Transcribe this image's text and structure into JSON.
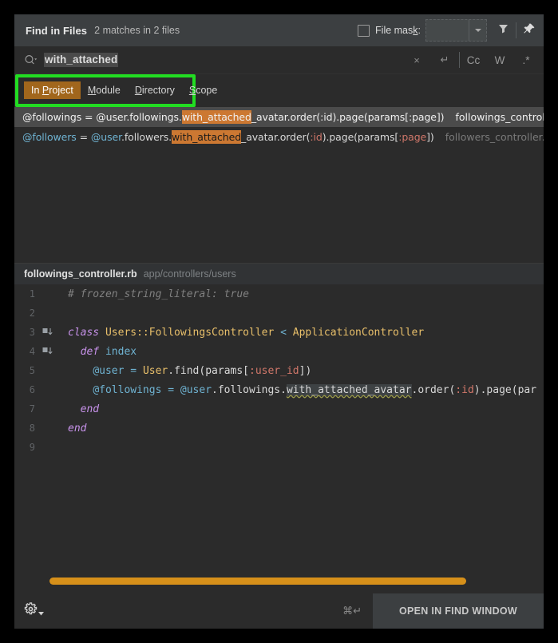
{
  "header": {
    "title": "Find in Files",
    "match_count": "2 matches in 2 files",
    "file_mask_label": "File mask:",
    "file_mask_checked": false,
    "file_mask_value": "",
    "filter_icon": "filter-icon",
    "pin_icon": "pin-icon"
  },
  "search": {
    "value": "with_attached",
    "placeholder": "",
    "search_icon": "search-icon",
    "clear_label": "×",
    "newline_label": "↵",
    "toggles": [
      {
        "label": "Cc",
        "name": "match-case-toggle"
      },
      {
        "label": "W",
        "name": "words-toggle"
      },
      {
        "label": ".*",
        "name": "regex-toggle"
      }
    ]
  },
  "scope": {
    "highlight_color": "#22dd22",
    "active_color": "#a1661c",
    "tabs": [
      {
        "label": "In Project",
        "mnemonic_before": "In ",
        "mnemonic": "P",
        "mnemonic_after": "roject",
        "active": true
      },
      {
        "label": "Module",
        "mnemonic_before": "",
        "mnemonic": "M",
        "mnemonic_after": "odule",
        "active": false
      },
      {
        "label": "Directory",
        "mnemonic_before": "",
        "mnemonic": "D",
        "mnemonic_after": "irectory",
        "active": false
      },
      {
        "label": "Scope",
        "mnemonic_before": "",
        "mnemonic": "S",
        "mnemonic_after": "cope",
        "active": false
      }
    ]
  },
  "results": [
    {
      "selected": true,
      "file": "followings_controller.rb",
      "line": "6",
      "parts": [
        {
          "t": "@followings = @user.followings.",
          "c": "c-ivar"
        },
        {
          "t": "with_attached",
          "c": "hl"
        },
        {
          "t": "_avatar.order(:id).page(params[:page])",
          "c": "c-plain"
        }
      ]
    },
    {
      "selected": false,
      "file": "followers_controller.rb",
      "line": "6",
      "parts": [
        {
          "t": "@followers",
          "c": "c-ivar"
        },
        {
          "t": " = ",
          "c": "c-plain"
        },
        {
          "t": "@user",
          "c": "c-ivar"
        },
        {
          "t": ".followers.",
          "c": "c-plain"
        },
        {
          "t": "with_attached",
          "c": "hl"
        },
        {
          "t": "_avatar.order(",
          "c": "c-plain"
        },
        {
          "t": ":id",
          "c": "c-sym"
        },
        {
          "t": ").page(params[",
          "c": "c-plain"
        },
        {
          "t": ":page",
          "c": "c-sym"
        },
        {
          "t": "])",
          "c": "c-plain"
        }
      ]
    }
  ],
  "preview": {
    "file_name": "followings_controller.rb",
    "file_path": "app/controllers/users",
    "lines": [
      {
        "num": "1",
        "icon": "",
        "changed": false,
        "parts": [
          {
            "t": "# frozen_string_literal: true",
            "c": "k-comment"
          }
        ]
      },
      {
        "num": "2",
        "icon": "",
        "changed": false,
        "parts": []
      },
      {
        "num": "3",
        "icon": "run-gutter-icon",
        "changed": false,
        "parts": [
          {
            "t": "class ",
            "c": "k-def"
          },
          {
            "t": "Users::FollowingsController",
            "c": "k-class"
          },
          {
            "t": " < ",
            "c": "k-op"
          },
          {
            "t": "ApplicationController",
            "c": "k-class"
          }
        ]
      },
      {
        "num": "4",
        "icon": "run-gutter-icon",
        "changed": false,
        "parts": [
          {
            "t": "  ",
            "c": "k-white"
          },
          {
            "t": "def ",
            "c": "k-def"
          },
          {
            "t": "index",
            "c": "k-op"
          }
        ]
      },
      {
        "num": "5",
        "icon": "",
        "changed": false,
        "parts": [
          {
            "t": "    ",
            "c": "k-white"
          },
          {
            "t": "@user",
            "c": "k-ivar2"
          },
          {
            "t": " = ",
            "c": "k-op"
          },
          {
            "t": "User",
            "c": "k-const"
          },
          {
            "t": ".find(params[",
            "c": "k-white"
          },
          {
            "t": ":user_id",
            "c": "k-sym"
          },
          {
            "t": "])",
            "c": "k-white"
          }
        ]
      },
      {
        "num": "6",
        "icon": "",
        "changed": true,
        "parts": [
          {
            "t": "    ",
            "c": "k-white"
          },
          {
            "t": "@followings",
            "c": "k-ivar2"
          },
          {
            "t": " = ",
            "c": "k-op"
          },
          {
            "t": "@user",
            "c": "k-ivar2"
          },
          {
            "t": ".followings.",
            "c": "k-white"
          },
          {
            "t": "with_attached_avatar",
            "c": "k-err"
          },
          {
            "t": ".order(",
            "c": "k-white"
          },
          {
            "t": ":id",
            "c": "k-sym"
          },
          {
            "t": ").page(par",
            "c": "k-white"
          }
        ]
      },
      {
        "num": "7",
        "icon": "",
        "changed": false,
        "parts": [
          {
            "t": "  ",
            "c": "k-white"
          },
          {
            "t": "end",
            "c": "k-def"
          }
        ]
      },
      {
        "num": "8",
        "icon": "",
        "changed": false,
        "parts": [
          {
            "t": "end",
            "c": "k-def"
          }
        ]
      },
      {
        "num": "9",
        "icon": "",
        "changed": false,
        "parts": []
      }
    ]
  },
  "bottom": {
    "gear_icon": "gear-icon",
    "shortcut": "⌘↵",
    "open_button": "OPEN IN FIND WINDOW",
    "scrollbar_color": "#d6901a"
  }
}
